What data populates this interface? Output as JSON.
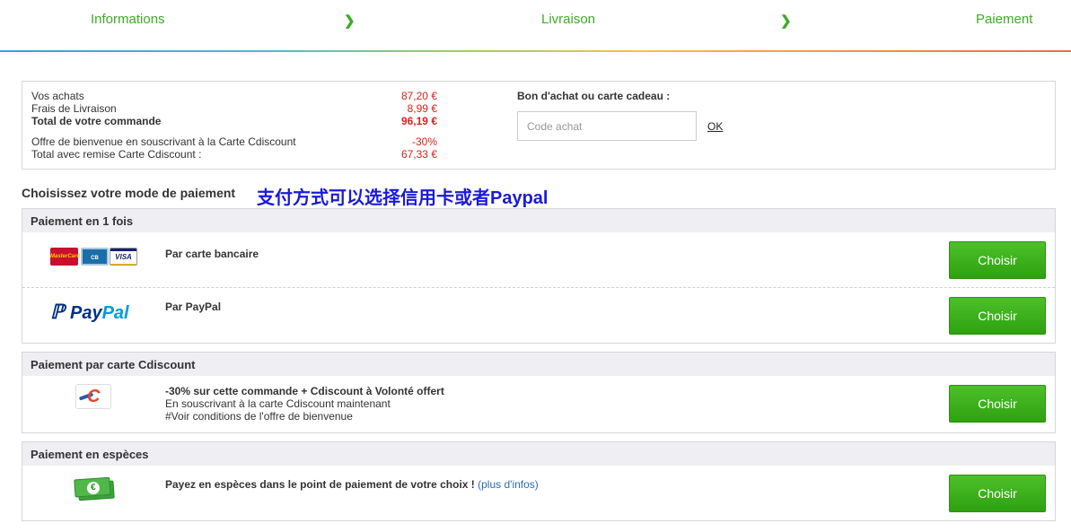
{
  "steps": {
    "step1": "Informations",
    "step2": "Livraison",
    "step3": "Paiement",
    "separator": "❯"
  },
  "summary": {
    "rows": [
      {
        "label": "Vos achats",
        "value": "87,20 €"
      },
      {
        "label": "Frais de Livraison",
        "value": "8,99 €"
      },
      {
        "label": "Total de votre commande",
        "value": "96,19 €"
      },
      {
        "label": "Offre de bienvenue en souscrivant à la Carte Cdiscount",
        "value": "-30%"
      },
      {
        "label": "Total avec remise Carte Cdiscount :",
        "value": "67,33 €"
      }
    ],
    "gift_title": "Bon d'achat ou carte cadeau :",
    "code_placeholder": "Code achat",
    "ok_label": "OK"
  },
  "heading": "Choisissez votre mode de paiement",
  "annotation": "支付方式可以选择信用卡或者Paypal",
  "sections": [
    {
      "title": "Paiement en 1 fois",
      "rows": [
        {
          "title": "Par carte bancaire",
          "button": "Choisir",
          "cards": [
            "MasterCard",
            "CB",
            "VISA"
          ]
        },
        {
          "title": "Par PayPal",
          "button": "Choisir",
          "logo_a": "Pay",
          "logo_b": "Pal"
        }
      ]
    },
    {
      "title": "Paiement par carte Cdiscount",
      "rows": [
        {
          "title": "-30% sur cette commande + Cdiscount à Volonté offert",
          "line2": "En souscrivant à la carte Cdiscount maintenant",
          "line3": "#Voir conditions de l'offre de bienvenue",
          "button": "Choisir"
        }
      ]
    },
    {
      "title": "Paiement en espèces",
      "rows": [
        {
          "title": "Payez en espèces dans le point de paiement de votre choix !",
          "more": "(plus d'infos)",
          "button": "Choisir"
        }
      ]
    }
  ],
  "colors": {
    "accent_green": "#3eab27",
    "price_red": "#d9221c",
    "annotation_blue": "#1a1adb",
    "button_green": "#2ea10f"
  }
}
